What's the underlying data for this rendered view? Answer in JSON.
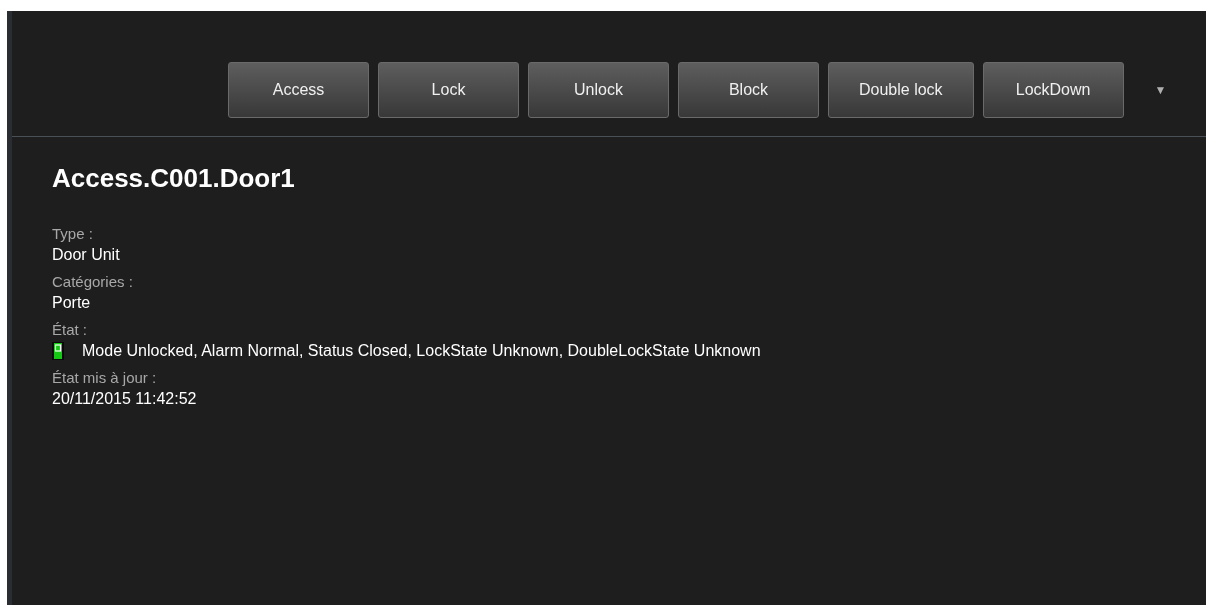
{
  "toolbar": {
    "buttons": [
      "Access",
      "Lock",
      "Unlock",
      "Block",
      "Double lock",
      "LockDown"
    ],
    "more": "▼"
  },
  "title": "Access.C001.Door1",
  "fields": [
    {
      "label": "Type :",
      "value": "Door Unit",
      "kind": "text"
    },
    {
      "label": "Catégories :",
      "value": "Porte",
      "kind": "text"
    },
    {
      "label": "État :",
      "value": "Mode Unlocked, Alarm Normal, Status Closed, LockState Unknown, DoubleLockState Unknown",
      "kind": "status",
      "color": "#14c814"
    },
    {
      "label": "État mis à jour :",
      "value": "20/11/2015 11:42:52",
      "kind": "text"
    }
  ]
}
